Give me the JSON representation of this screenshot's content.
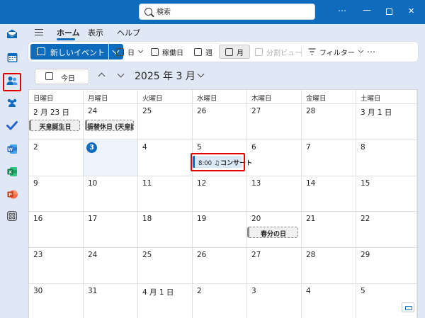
{
  "search": {
    "placeholder": "検索"
  },
  "titlebar": {
    "more": "⋯",
    "minimize": "—",
    "close": "✕"
  },
  "rail": [
    {
      "id": "mail",
      "icon": "mail-icon",
      "color": "#0f6cbd"
    },
    {
      "id": "calendar",
      "icon": "calendar-icon",
      "color": "#0f6cbd",
      "active": true
    },
    {
      "id": "people",
      "icon": "people-icon",
      "color": "#0f6cbd"
    },
    {
      "id": "groups",
      "icon": "groups-icon",
      "color": "#0f6cbd"
    },
    {
      "id": "todo",
      "icon": "todo-check-icon",
      "color": "#2564cf"
    },
    {
      "id": "word",
      "icon": "word-icon",
      "color": "#185abd",
      "letter": "W"
    },
    {
      "id": "excel",
      "icon": "excel-icon",
      "color": "#107c41",
      "letter": "X"
    },
    {
      "id": "powerpoint",
      "icon": "powerpoint-icon",
      "color": "#c43e1c",
      "letter": "P"
    },
    {
      "id": "apps",
      "icon": "apps-icon",
      "color": "#444444"
    }
  ],
  "tabs": [
    {
      "label": "ホーム",
      "active": true
    },
    {
      "label": "表示"
    },
    {
      "label": "ヘルプ"
    }
  ],
  "toolbar": {
    "new_event": "新しいイベント",
    "day": "日",
    "work_week": "稼働日",
    "week": "週",
    "month": "月",
    "split_view": "分割ビュー",
    "filter": "フィルター",
    "more": "⋯"
  },
  "nav": {
    "today": "今日",
    "month_title": "2025 年 3 月"
  },
  "calendar": {
    "weekdays": [
      "日曜日",
      "月曜日",
      "火曜日",
      "水曜日",
      "木曜日",
      "金曜日",
      "土曜日"
    ],
    "weeks": [
      [
        "2 月 23 日",
        "24",
        "25",
        "26",
        "27",
        "28",
        "3 月 1 日"
      ],
      [
        "2",
        "3",
        "4",
        "5",
        "6",
        "7",
        "8"
      ],
      [
        "9",
        "10",
        "11",
        "12",
        "13",
        "14",
        "15"
      ],
      [
        "16",
        "17",
        "18",
        "19",
        "20",
        "21",
        "22"
      ],
      [
        "23",
        "24",
        "25",
        "26",
        "27",
        "28",
        "29"
      ],
      [
        "30",
        "31",
        "4 月 1 日",
        "2",
        "3",
        "4",
        "5"
      ]
    ],
    "today_label": "3",
    "allday_events": [
      {
        "title": "天皇誕生日"
      },
      {
        "title": "振替休日 (天皇誕"
      },
      {
        "title": "春分の日"
      }
    ],
    "event": {
      "time": "8:00",
      "icon": "music-note-icon",
      "title": "コンサート"
    }
  }
}
